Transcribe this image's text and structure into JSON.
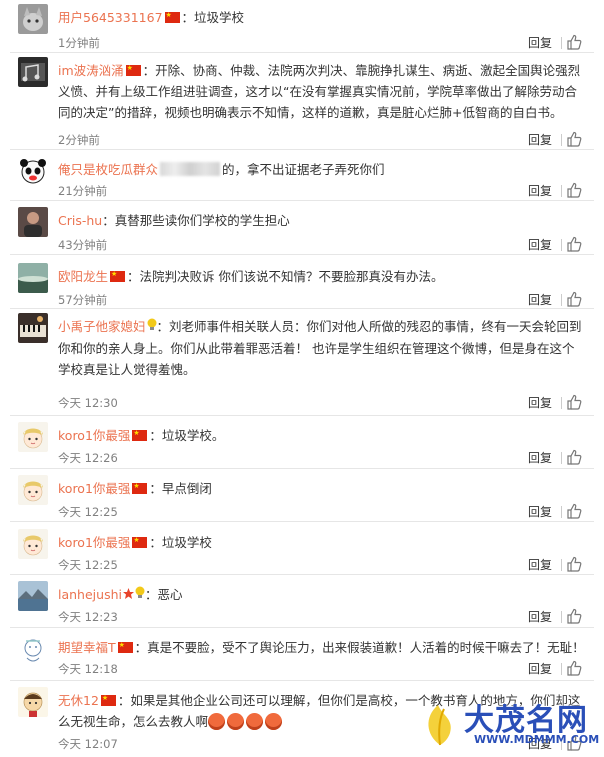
{
  "actions": {
    "reply": "回复"
  },
  "colors": {
    "username": "#eb7350",
    "meta": "#808080",
    "watermark": "#2a4fb8"
  },
  "comments": [
    {
      "avatar": "cat-photo-avatar",
      "user": "用户5645331167",
      "flag": true,
      "badge": "",
      "blurred": false,
      "text": "：垃圾学校",
      "emojis": 0,
      "time": "1分钟前"
    },
    {
      "avatar": "music-photo-avatar",
      "user": "im波涛汹涌",
      "flag": true,
      "badge": "",
      "blurred": false,
      "text": "：开除、协商、仲裁、法院两次判决、靠腕挣扎谋生、病逝、激起全国舆论强烈义愤、并有上级工作组进驻调查，这才以“在没有掌握真实情况前，学院草率做出了解除劳动合同的决定”的措辞，视频也明确表示不知情，这样的道歉，真是脏心烂肺+低智商的自白书。",
      "emojis": 0,
      "time": "2分钟前"
    },
    {
      "avatar": "panda-avatar",
      "user": "俺只是枚吃瓜群众",
      "flag": false,
      "badge": "",
      "blurred": true,
      "text": "的，拿不出证据老子弄死你们",
      "emojis": 0,
      "time": "21分钟前"
    },
    {
      "avatar": "person-photo-avatar",
      "user": "Cris-hu",
      "flag": false,
      "badge": "",
      "blurred": false,
      "text": "：真替那些读你们学校的学生担心",
      "emojis": 0,
      "time": "43分钟前"
    },
    {
      "avatar": "landscape-photo-avatar",
      "user": "欧阳龙生",
      "flag": true,
      "badge": "",
      "blurred": false,
      "text": "：法院判决败诉 你们该说不知情？不要脸那真没有办法。",
      "emojis": 0,
      "time": "57分钟前"
    },
    {
      "avatar": "piano-photo-avatar",
      "user": "小禹子他家媳妇",
      "flag": false,
      "badge": "bulb-badge",
      "blurred": false,
      "text": "：刘老师事件相关联人员：你们对他人所做的残忍的事情，终有一天会轮回到你和你的亲人身上。你们从此带着罪恶活着！ 也许是学生组织在管理这个微博，但是身在这个学校真是让人觉得羞愧。",
      "emojis": 0,
      "time": "今天 12:30"
    },
    {
      "avatar": "cartoon-boy-avatar",
      "user": "koro1你最强",
      "flag": true,
      "badge": "",
      "blurred": false,
      "text": "：垃圾学校。",
      "emojis": 0,
      "time": "今天 12:26"
    },
    {
      "avatar": "cartoon-boy-avatar",
      "user": "koro1你最强",
      "flag": true,
      "badge": "",
      "blurred": false,
      "text": "：早点倒闭",
      "emojis": 0,
      "time": "今天 12:25"
    },
    {
      "avatar": "cartoon-boy-avatar",
      "user": "koro1你最强",
      "flag": true,
      "badge": "",
      "blurred": false,
      "text": "：垃圾学校",
      "emojis": 0,
      "time": "今天 12:25"
    },
    {
      "avatar": "lake-photo-avatar",
      "user": "lanhejushi",
      "flag": false,
      "badge": "star-bulb-badge",
      "blurred": false,
      "text": "：恶心",
      "emojis": 0,
      "time": "今天 12:23"
    },
    {
      "avatar": "sketch-avatar",
      "user": "期望幸福T",
      "flag": true,
      "badge": "",
      "blurred": false,
      "text": "：真是不要脸，受不了舆论压力，出来假装道歉！人活着的时候干嘛去了！无耻！",
      "emojis": 0,
      "time": "今天 12:18"
    },
    {
      "avatar": "cartoon-man-avatar",
      "user": "无休12",
      "flag": true,
      "badge": "",
      "blurred": false,
      "text": "：如果是其他企业公司还可以理解，但你们是高校，一个教书育人的地方，你们却这么无视生命，怎么去教人啊",
      "emojis": 4,
      "time": "今天 12:07"
    }
  ],
  "watermark": {
    "title": "大茂名网",
    "url": "WWW.MDMMM.COM"
  }
}
